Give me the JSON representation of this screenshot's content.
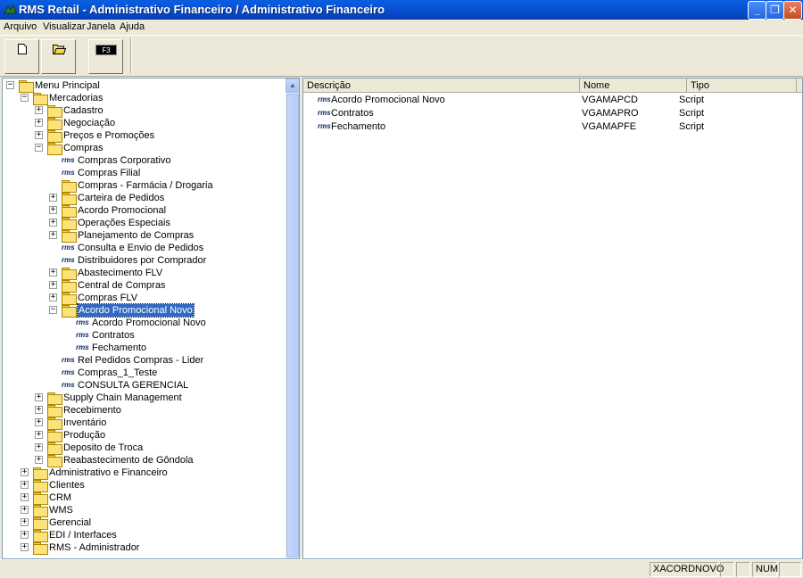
{
  "window": {
    "title": "RMS Retail - Administrativo Financeiro / Administrativo Financeiro",
    "minimize_symbol": "_",
    "maximize_symbol": "❐",
    "close_symbol": "✕"
  },
  "menu": [
    "Arquivo",
    "Visualizar",
    "Janela",
    "Ajuda"
  ],
  "toolbar": {
    "new_icon": "new-document-icon",
    "open_icon": "open-folder-icon",
    "f3_label": "F3"
  },
  "tree": {
    "nodes": [
      {
        "label": "Menu Principal",
        "kind": "folder",
        "exp": "−",
        "level": 0
      },
      {
        "label": "Mercadorias",
        "kind": "folder",
        "exp": "−",
        "level": 1
      },
      {
        "label": "Cadastro",
        "kind": "folder",
        "exp": "+",
        "level": 2
      },
      {
        "label": "Negociação",
        "kind": "folder",
        "exp": "+",
        "level": 2
      },
      {
        "label": "Preços e Promoções",
        "kind": "folder",
        "exp": "+",
        "level": 2
      },
      {
        "label": "Compras",
        "kind": "folder",
        "exp": "−",
        "level": 2
      },
      {
        "label": "Compras Corporativo",
        "kind": "script",
        "level": 3
      },
      {
        "label": "Compras Filial",
        "kind": "script",
        "level": 3
      },
      {
        "label": "Compras - Farmácia / Drogaria",
        "kind": "folder",
        "level": 3
      },
      {
        "label": "Carteira de Pedidos",
        "kind": "folder",
        "exp": "+",
        "level": 3
      },
      {
        "label": "Acordo Promocional",
        "kind": "folder",
        "exp": "+",
        "level": 3
      },
      {
        "label": "Operações Especiais",
        "kind": "folder",
        "exp": "+",
        "level": 3
      },
      {
        "label": "Planejamento de Compras",
        "kind": "folder",
        "exp": "+",
        "level": 3
      },
      {
        "label": "Consulta e Envio de Pedidos",
        "kind": "script",
        "level": 3
      },
      {
        "label": "Distribuidores por Comprador",
        "kind": "script",
        "level": 3
      },
      {
        "label": "Abastecimento FLV",
        "kind": "folder",
        "exp": "+",
        "level": 3
      },
      {
        "label": "Central de Compras",
        "kind": "folder",
        "exp": "+",
        "level": 3
      },
      {
        "label": "Compras FLV",
        "kind": "folder",
        "exp": "+",
        "level": 3
      },
      {
        "label": "Acordo Promocional Novo",
        "kind": "folder",
        "exp": "−",
        "level": 3,
        "selected": true
      },
      {
        "label": "Acordo Promocional Novo",
        "kind": "script",
        "level": 4
      },
      {
        "label": "Contratos",
        "kind": "script",
        "level": 4
      },
      {
        "label": "Fechamento",
        "kind": "script",
        "level": 4
      },
      {
        "label": "Rel Pedidos Compras - Lider",
        "kind": "script",
        "level": 3
      },
      {
        "label": "Compras_1_Teste",
        "kind": "script",
        "level": 3
      },
      {
        "label": "CONSULTA GERENCIAL",
        "kind": "script",
        "level": 3
      },
      {
        "label": "Supply Chain Management",
        "kind": "folder",
        "exp": "+",
        "level": 2
      },
      {
        "label": "Recebimento",
        "kind": "folder",
        "exp": "+",
        "level": 2
      },
      {
        "label": "Inventário",
        "kind": "folder",
        "exp": "+",
        "level": 2
      },
      {
        "label": "Produção",
        "kind": "folder",
        "exp": "+",
        "level": 2
      },
      {
        "label": "Deposito de Troca",
        "kind": "folder",
        "exp": "+",
        "level": 2
      },
      {
        "label": "Reabastecimento de Gôndola",
        "kind": "folder",
        "exp": "+",
        "level": 2
      },
      {
        "label": "Administrativo e Financeiro",
        "kind": "folder",
        "exp": "+",
        "level": 1
      },
      {
        "label": "Clientes",
        "kind": "folder",
        "exp": "+",
        "level": 1
      },
      {
        "label": "CRM",
        "kind": "folder",
        "exp": "+",
        "level": 1
      },
      {
        "label": "WMS",
        "kind": "folder",
        "exp": "+",
        "level": 1
      },
      {
        "label": "Gerencial",
        "kind": "folder",
        "exp": "+",
        "level": 1
      },
      {
        "label": "EDI / Interfaces",
        "kind": "folder",
        "exp": "+",
        "level": 1
      },
      {
        "label": "RMS - Administrador",
        "kind": "folder",
        "exp": "+",
        "level": 1
      }
    ],
    "script_icon_text": "rms",
    "scroll_up": "▲"
  },
  "list": {
    "columns": [
      "Descrição",
      "Nome",
      "Tipo"
    ],
    "rows": [
      {
        "descricao": "Acordo Promocional Novo",
        "nome": "VGAMAPCD",
        "tipo": "Script"
      },
      {
        "descricao": "Contratos",
        "nome": "VGAMAPRO",
        "tipo": "Script"
      },
      {
        "descricao": "Fechamento",
        "nome": "VGAMAPFE",
        "tipo": "Script"
      }
    ]
  },
  "status": {
    "panel1": "XACORDNOVO",
    "panel2": "",
    "panel3": "",
    "panel4": "NUM",
    "panel5": ""
  }
}
